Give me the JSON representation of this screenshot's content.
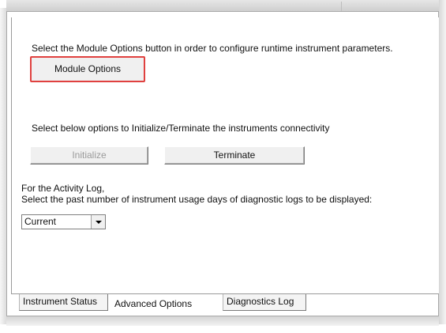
{
  "instructions": {
    "module_options_text": "Select the Module Options button in order to configure runtime instrument parameters.",
    "connectivity_text": "Select below options to Initialize/Terminate the instruments connectivity",
    "activity_log_line1": "For the Activity Log,",
    "activity_log_line2": "Select the past number of instrument usage days of diagnostic logs to be displayed:"
  },
  "buttons": {
    "module_options": "Module Options",
    "initialize": "Initialize",
    "terminate": "Terminate"
  },
  "log_days_select": {
    "value": "Current"
  },
  "tabs": [
    {
      "label": "Instrument Status",
      "active": false
    },
    {
      "label": "Advanced Options",
      "active": true
    },
    {
      "label": "Diagnostics Log",
      "active": false
    }
  ],
  "colors": {
    "highlight_border": "#e0413f",
    "disabled_text": "#9a9a9a"
  }
}
